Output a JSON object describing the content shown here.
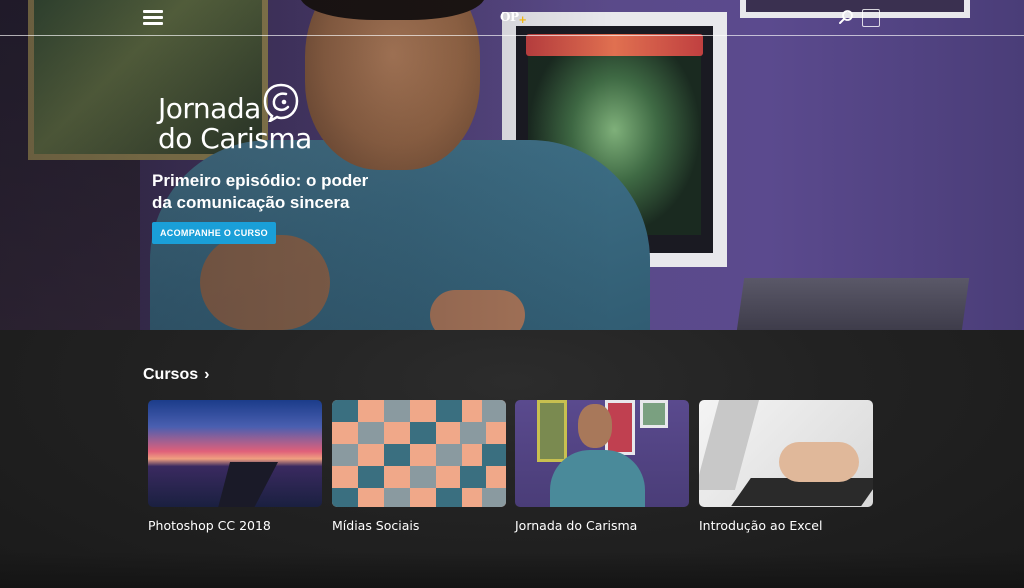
{
  "header": {
    "logo_text": "OP",
    "logo_plus": "+"
  },
  "hero": {
    "brand_line1": "Jornada",
    "brand_line2": "do Carisma",
    "headline": "Primeiro episódio: o poder da comunicação sincera",
    "cta_label": "ACOMPANHE O CURSO"
  },
  "courses": {
    "title": "Cursos",
    "chevron": "›",
    "items": [
      {
        "label": "Photoshop CC 2018"
      },
      {
        "label": "Mídias Sociais"
      },
      {
        "label": "Jornada do Carisma"
      },
      {
        "label": "Introdução ao Excel"
      }
    ]
  },
  "colors": {
    "accent": "#1a9fd8",
    "logo_plus": "#f2b400",
    "background": "#1f1f1f"
  }
}
